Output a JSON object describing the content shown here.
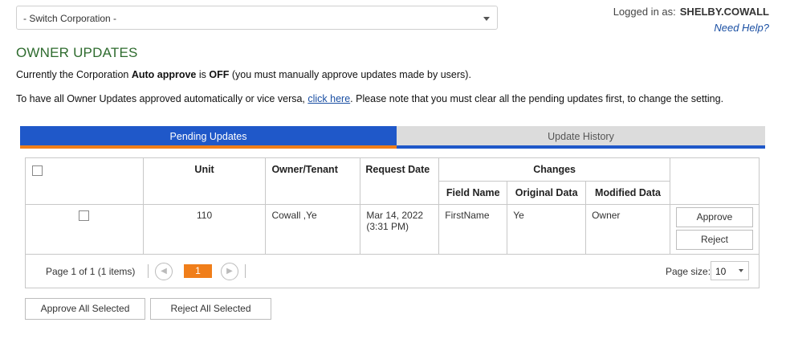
{
  "header": {
    "switch_corp": "- Switch Corporation -",
    "logged_in_label": "Logged in as:",
    "username": "SHELBY.COWALL",
    "help_link": "Need Help?"
  },
  "page": {
    "title": "OWNER UPDATES",
    "line1_pre": "Currently the Corporation ",
    "line1_bold1": "Auto approve",
    "line1_mid": " is ",
    "line1_bold2": "OFF",
    "line1_post": " (you must manually approve updates made by users).",
    "line2_pre": "To have all Owner Updates approved automatically or vice versa, ",
    "line2_link": "click here",
    "line2_post": ". Please note that you must clear all the pending updates first, to change the setting."
  },
  "tabs": {
    "pending": "Pending Updates",
    "history": "Update History"
  },
  "table": {
    "headers": {
      "unit": "Unit",
      "owner": "Owner/Tenant",
      "request_date": "Request Date",
      "changes": "Changes",
      "field_name": "Field Name",
      "original_data": "Original Data",
      "modified_data": "Modified Data"
    },
    "rows": [
      {
        "unit": "110",
        "owner": "Cowall ,Ye",
        "request_date": "Mar 14, 2022",
        "request_time": "(3:31 PM)",
        "field_name": "FirstName",
        "original_data": "Ye",
        "modified_data": "Owner",
        "approve_label": "Approve",
        "reject_label": "Reject"
      }
    ]
  },
  "pager": {
    "info": "Page 1 of 1 (1 items)",
    "prev_icon": "◀",
    "next_icon": "▶",
    "current_page": "1",
    "size_label": "Page size:",
    "size_value": "10"
  },
  "actions": {
    "approve_all": "Approve All Selected",
    "reject_all": "Reject All Selected"
  },
  "colors": {
    "tab_active": "#1f58c9",
    "tab_accent": "#f07e1a",
    "title_green": "#2e6b2e",
    "link_blue": "#1a4fa3"
  }
}
